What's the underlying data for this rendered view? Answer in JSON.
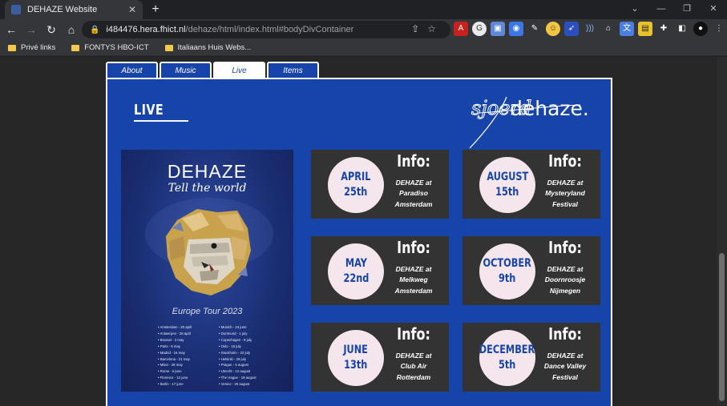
{
  "browser": {
    "tab_title": "DEHAZE Website",
    "tab_close": "✕",
    "new_tab": "+",
    "url_host": "i484476.hera.fhict.nl",
    "url_path": "/dehaze/html/index.html#bodyDivContainer",
    "bookmarks": [
      {
        "label": "Privé links"
      },
      {
        "label": "FONTYS HBO-ICT"
      },
      {
        "label": "Italiaans Huis Webs..."
      }
    ]
  },
  "nav": {
    "tabs": [
      {
        "label": "About",
        "active": false
      },
      {
        "label": "Music",
        "active": false
      },
      {
        "label": "Live",
        "active": true
      },
      {
        "label": "Items",
        "active": false
      }
    ]
  },
  "page": {
    "title": "LIVE",
    "logo_script": "sjoerd",
    "logo_text": "dehaze."
  },
  "poster": {
    "title": "DEHAZE",
    "subtitle": "Tell the world",
    "tour": "Europe Tour 2023",
    "dates_left": [
      "• Amsterdam - 20 april",
      "• Antwerpen - 26 april",
      "• Brussel - 2 may",
      "• Paris - 9 may",
      "• Madrid - 16 may",
      "• Barcelona - 21 may",
      "• Milan - 28 may",
      "• Rome - 5 june",
      "• Florence - 12 june",
      "• Berlin - 17 june"
    ],
    "dates_right": [
      "• Munich - 24 june",
      "• Dortmund - 1 july",
      "• Copenhagen - 8 july",
      "• Oslo - 15 july",
      "• Stockholm - 22 july",
      "• Helsinki - 29 july",
      "• Prague - 5 august",
      "• Utrecht - 12 august",
      "• The Hague - 19 august",
      "• Venice - 26 august"
    ]
  },
  "events": [
    {
      "month": "APRIL",
      "day": "25th",
      "info_heading": "Info:",
      "line1": "DEHAZE at",
      "line2": "Paradiso",
      "line3": "Amsterdam"
    },
    {
      "month": "AUGUST",
      "day": "15th",
      "info_heading": "Info:",
      "line1": "DEHAZE at",
      "line2": "Mysteryland",
      "line3": "Festival"
    },
    {
      "month": "MAY",
      "day": "22nd",
      "info_heading": "Info:",
      "line1": "DEHAZE at",
      "line2": "Melkweg",
      "line3": "Amsterdam"
    },
    {
      "month": "OCTOBER",
      "day": "9th",
      "info_heading": "Info:",
      "line1": "DEHAZE at",
      "line2": "Doornroosje",
      "line3": "Nijmegen"
    },
    {
      "month": "JUNE",
      "day": "13th",
      "info_heading": "Info:",
      "line1": "DEHAZE at",
      "line2": "Club Air",
      "line3": "Rotterdam"
    },
    {
      "month": "DECEMBER",
      "day": "5th",
      "info_heading": "Info:",
      "line1": "DEHAZE at",
      "line2": "Dance Valley",
      "line3": "Festival"
    }
  ],
  "colors": {
    "brand_blue": "#1744a8",
    "card_bg": "#333333",
    "circle_bg": "#f5e6ee"
  }
}
